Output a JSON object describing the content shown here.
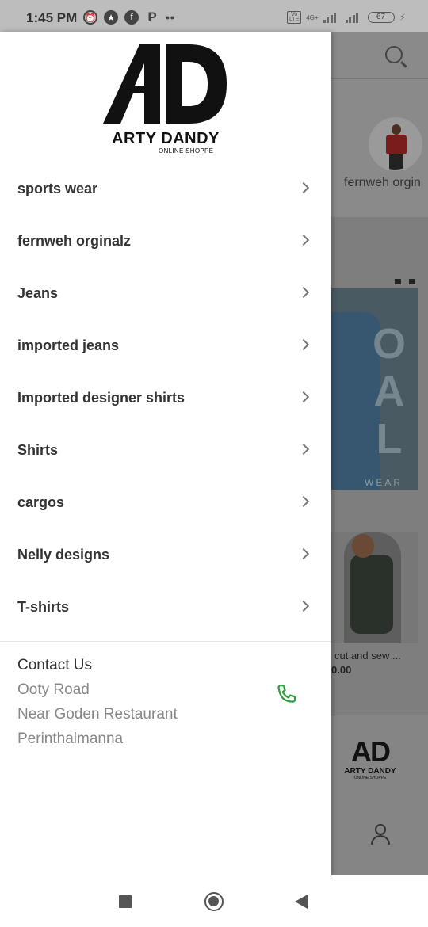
{
  "status_bar": {
    "time": "1:45 PM",
    "network": "4G+",
    "volte": "Vo LTE",
    "battery": "67"
  },
  "drawer": {
    "logo": {
      "mark": "AD",
      "brand": "ARTY DANDY",
      "tagline": "ONLINE SHOPPE"
    },
    "menu": [
      {
        "label": "sports wear"
      },
      {
        "label": "fernweh orginalz"
      },
      {
        "label": "Jeans"
      },
      {
        "label": "imported jeans"
      },
      {
        "label": "Imported designer shirts"
      },
      {
        "label": "Shirts"
      },
      {
        "label": "cargos"
      },
      {
        "label": "Nelly designs"
      },
      {
        "label": "T-shirts"
      }
    ],
    "contact": {
      "title": "Contact Us",
      "lines": [
        "Ooty Road",
        "Near Goden Restaurant",
        "Perinthalmanna"
      ],
      "phone_icon_color": "#2e9e3e"
    }
  },
  "background": {
    "category_label": "fernweh orgin",
    "banner_letters": "OAL",
    "banner_word": "WEAR",
    "product_name": "cut and sew ...",
    "product_price": "0.00",
    "footer_logo": {
      "mark": "AD",
      "brand": "ARTY DANDY",
      "tagline": "ONLINE SHOPPE"
    }
  },
  "colors": {
    "overlay": "#7e7e7e",
    "status_bar": "#bdbdbd",
    "menu_text": "#333333",
    "contact_text": "#888888"
  }
}
